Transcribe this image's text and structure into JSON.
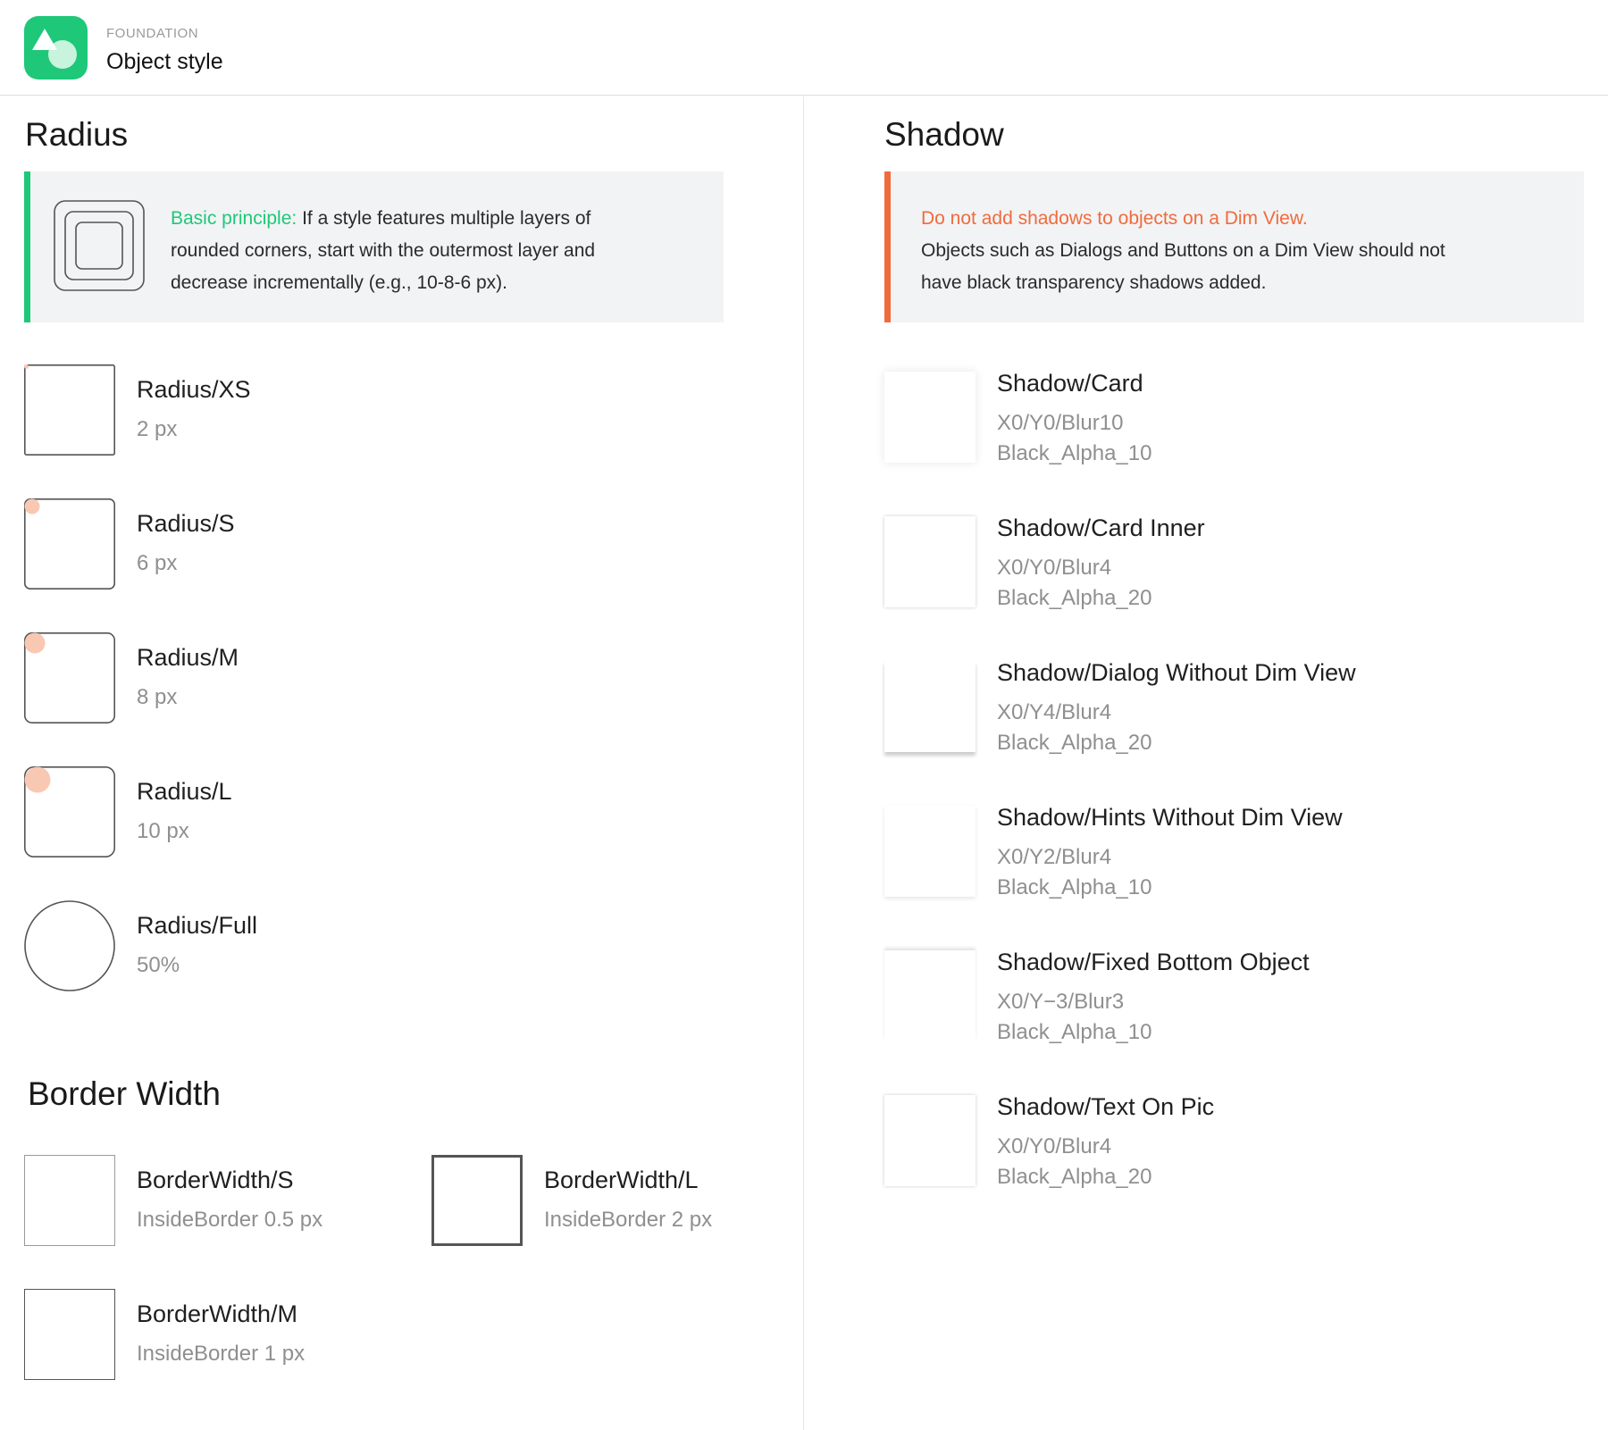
{
  "header": {
    "kicker": "FOUNDATION",
    "title": "Object style",
    "logo_icon": "shapes-logo-icon"
  },
  "colors": {
    "brand": "#1ec878",
    "warning": "#f06b3c",
    "marker": "#f9c8b2",
    "stroke": "#555555",
    "callout_bg": "#f2f3f5"
  },
  "radius": {
    "title": "Radius",
    "note": {
      "label": "Basic principle:",
      "lines": [
        "If a style features multiple layers of",
        "rounded corners, start with the outermost layer and",
        "decrease incrementally (e.g., 10-8-6 px)."
      ],
      "icon": "nested-rounded-squares-icon"
    },
    "items": [
      {
        "name": "Radius/XS",
        "value": "2 px"
      },
      {
        "name": "Radius/S",
        "value": "6 px"
      },
      {
        "name": "Radius/M",
        "value": "8 px"
      },
      {
        "name": "Radius/L",
        "value": "10 px"
      },
      {
        "name": "Radius/Full",
        "value": "50%"
      }
    ]
  },
  "border": {
    "title": "Border Width",
    "items": [
      {
        "name": "BorderWidth/S",
        "value": "InsideBorder 0.5 px"
      },
      {
        "name": "BorderWidth/M",
        "value": "InsideBorder 1 px"
      },
      {
        "name": "BorderWidth/L",
        "value": "InsideBorder 2 px"
      }
    ]
  },
  "shadow": {
    "title": "Shadow",
    "note": {
      "warning": "Do not add shadows to objects on a Dim View.",
      "lines": [
        "Objects such as Dialogs and Buttons on a Dim View should not",
        "have black transparency shadows added."
      ]
    },
    "items": [
      {
        "name": "Shadow/Card",
        "spec": "X0/Y0/Blur10",
        "color": "Black_Alpha_10"
      },
      {
        "name": "Shadow/Card Inner",
        "spec": "X0/Y0/Blur4",
        "color": "Black_Alpha_20"
      },
      {
        "name": "Shadow/Dialog Without Dim View",
        "spec": "X0/Y4/Blur4",
        "color": "Black_Alpha_20"
      },
      {
        "name": "Shadow/Hints Without Dim View",
        "spec": "X0/Y2/Blur4",
        "color": "Black_Alpha_10"
      },
      {
        "name": "Shadow/Fixed Bottom Object",
        "spec": "X0/Y−3/Blur3",
        "color": "Black_Alpha_10"
      },
      {
        "name": "Shadow/Text On Pic",
        "spec": "X0/Y0/Blur4",
        "color": "Black_Alpha_20"
      }
    ]
  }
}
